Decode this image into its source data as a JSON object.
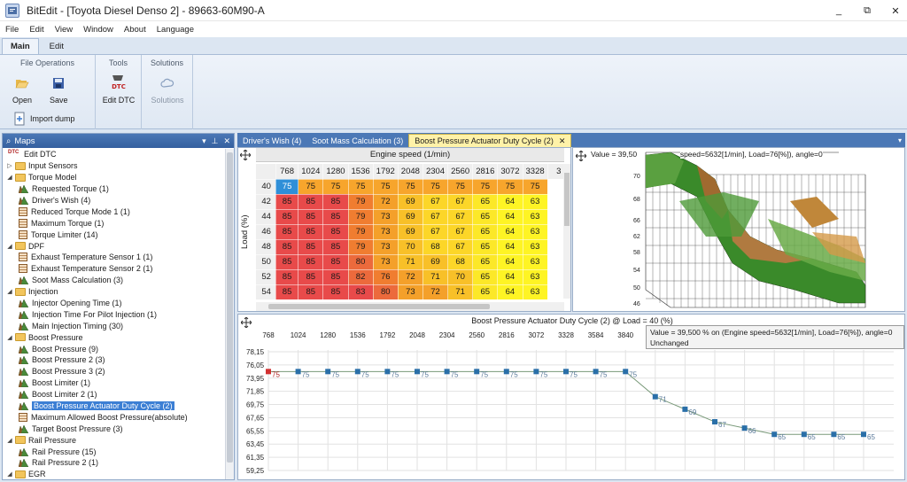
{
  "window": {
    "title": "BitEdit - [Toyota Diesel Denso 2] - 89663-60M90-A",
    "controls": [
      "_",
      "⧉",
      "✕"
    ]
  },
  "menu": [
    "File",
    "Edit",
    "View",
    "Window",
    "About",
    "Language"
  ],
  "ribbon_tabs": [
    "Main",
    "Edit"
  ],
  "ribbon": {
    "file_operations": "File Operations",
    "open": "Open",
    "save": "Save",
    "import_dump": "Import dump",
    "tools": "Tools",
    "edit_dtc": "Edit DTC",
    "solutions_group": "Solutions",
    "solutions": "Solutions"
  },
  "maps_panel": {
    "title": "Maps",
    "items": [
      {
        "label": "Edit DTC",
        "kind": "dtc",
        "level": 0
      },
      {
        "label": "Input Sensors",
        "kind": "folder",
        "level": 0,
        "expanded": false
      },
      {
        "label": "Torque Model",
        "kind": "folder",
        "level": 0,
        "expanded": true
      },
      {
        "label": "Requested Torque (1)",
        "kind": "map3d",
        "level": 1
      },
      {
        "label": "Driver's Wish (4)",
        "kind": "map3d",
        "level": 1
      },
      {
        "label": "Reduced Torque Mode 1 (1)",
        "kind": "table",
        "level": 1
      },
      {
        "label": "Maximum Torque (1)",
        "kind": "table",
        "level": 1
      },
      {
        "label": "Torque Limiter (14)",
        "kind": "table",
        "level": 1
      },
      {
        "label": "DPF",
        "kind": "folder",
        "level": 0,
        "expanded": true
      },
      {
        "label": "Exhaust Temperature Sensor 1 (1)",
        "kind": "table",
        "level": 1
      },
      {
        "label": "Exhaust Temperature Sensor 2 (1)",
        "kind": "table",
        "level": 1
      },
      {
        "label": "Soot Mass Calculation (3)",
        "kind": "map3d",
        "level": 1
      },
      {
        "label": "Injection",
        "kind": "folder",
        "level": 0,
        "expanded": true
      },
      {
        "label": "Injector Opening Time (1)",
        "kind": "map3d",
        "level": 1
      },
      {
        "label": "Injection Time For Pilot Injection (1)",
        "kind": "map3d",
        "level": 1
      },
      {
        "label": "Main Injection Timing (30)",
        "kind": "map3d",
        "level": 1
      },
      {
        "label": "Boost Pressure",
        "kind": "folder",
        "level": 0,
        "expanded": true
      },
      {
        "label": "Boost Pressure (9)",
        "kind": "map3d",
        "level": 1
      },
      {
        "label": "Boost Pressure 2 (3)",
        "kind": "map3d",
        "level": 1
      },
      {
        "label": "Boost Pressure 3 (2)",
        "kind": "map3d",
        "level": 1
      },
      {
        "label": "Boost Limiter (1)",
        "kind": "map3d",
        "level": 1
      },
      {
        "label": "Boost Limiter 2 (1)",
        "kind": "map3d",
        "level": 1
      },
      {
        "label": "Boost Pressure Actuator Duty Cycle (2)",
        "kind": "map3d",
        "level": 1,
        "selected": true
      },
      {
        "label": "Maximum Allowed Boost Pressure(absolute)",
        "kind": "table",
        "level": 1
      },
      {
        "label": "Target Boost Pressure (3)",
        "kind": "map3d",
        "level": 1
      },
      {
        "label": "Rail Pressure",
        "kind": "folder",
        "level": 0,
        "expanded": true
      },
      {
        "label": "Rail Pressure (15)",
        "kind": "map3d",
        "level": 1
      },
      {
        "label": "Rail Pressure 2 (1)",
        "kind": "map3d",
        "level": 1
      },
      {
        "label": "EGR",
        "kind": "folder",
        "level": 0,
        "expanded": true
      }
    ]
  },
  "doc_tabs": [
    {
      "label": "Driver's Wish (4)",
      "active": false
    },
    {
      "label": "Soot Mass Calculation (3)",
      "active": false
    },
    {
      "label": "Boost Pressure Actuator Duty Cycle (2)",
      "active": true
    }
  ],
  "grid": {
    "x_axis_title": "Engine speed (1/min)",
    "y_axis_title": "Load (%)",
    "columns": [
      "768",
      "1024",
      "1280",
      "1536",
      "1792",
      "2048",
      "2304",
      "2560",
      "2816",
      "3072",
      "3328",
      "3"
    ],
    "rows": [
      {
        "load": "40",
        "values": [
          "75",
          "75",
          "75",
          "75",
          "75",
          "75",
          "75",
          "75",
          "75",
          "75",
          "75",
          ""
        ]
      },
      {
        "load": "42",
        "values": [
          "85",
          "85",
          "85",
          "79",
          "72",
          "69",
          "67",
          "67",
          "65",
          "64",
          "63",
          ""
        ]
      },
      {
        "load": "44",
        "values": [
          "85",
          "85",
          "85",
          "79",
          "73",
          "69",
          "67",
          "67",
          "65",
          "64",
          "63",
          ""
        ]
      },
      {
        "load": "46",
        "values": [
          "85",
          "85",
          "85",
          "79",
          "73",
          "69",
          "67",
          "67",
          "65",
          "64",
          "63",
          ""
        ]
      },
      {
        "load": "48",
        "values": [
          "85",
          "85",
          "85",
          "79",
          "73",
          "70",
          "68",
          "67",
          "65",
          "64",
          "63",
          ""
        ]
      },
      {
        "load": "50",
        "values": [
          "85",
          "85",
          "85",
          "80",
          "73",
          "71",
          "69",
          "68",
          "65",
          "64",
          "63",
          ""
        ]
      },
      {
        "load": "52",
        "values": [
          "85",
          "85",
          "85",
          "82",
          "76",
          "72",
          "71",
          "70",
          "65",
          "64",
          "63",
          ""
        ]
      },
      {
        "load": "54",
        "values": [
          "85",
          "85",
          "85",
          "83",
          "80",
          "73",
          "72",
          "71",
          "65",
          "64",
          "63",
          ""
        ]
      }
    ]
  },
  "three_d": {
    "info": "Value = 39,500 % on (Engine speed=5632[1/min], Load=76[%]), angle=0",
    "info_visible": "Value = 39,50",
    "info_visible_2": "speed=5632[1/min], Load=76[%]), angle=0",
    "tick_labels": [
      "70",
      "68",
      "66",
      "62",
      "58",
      "54",
      "50",
      "46"
    ]
  },
  "tooltip": {
    "line1": "Value = 39,500 % on (Engine speed=5632[1/min], Load=76[%]), angle=0",
    "line2": "Unchanged"
  },
  "chart_data": {
    "type": "line",
    "title": "Boost Pressure Actuator Duty Cycle (2) @ Load = 40 (%)",
    "x": [
      768,
      1024,
      1280,
      1536,
      1792,
      2048,
      2304,
      2560,
      2816,
      3072,
      3328,
      3584,
      3840,
      4096,
      4352,
      4608,
      4864,
      5120,
      5376,
      5632,
      5888
    ],
    "x_tick_labels": [
      "768",
      "1024",
      "1280",
      "1536",
      "1792",
      "2048",
      "2304",
      "2560",
      "2816",
      "3072",
      "3328",
      "3584",
      "3840"
    ],
    "y_tick_labels": [
      "78,15",
      "76,05",
      "73,95",
      "71,85",
      "69,75",
      "67,65",
      "65,55",
      "63,45",
      "61,35",
      "59,25"
    ],
    "ylim": [
      59.25,
      78.15
    ],
    "series": [
      {
        "values": [
          75,
          75,
          75,
          75,
          75,
          75,
          75,
          75,
          75,
          75,
          75,
          75,
          75,
          71,
          69,
          67,
          66,
          65,
          65,
          65,
          65
        ],
        "labels": [
          "75",
          "75",
          "75",
          "75",
          "75",
          "75",
          "75",
          "75",
          "75",
          "75",
          "75",
          "75",
          "75",
          "71",
          "69",
          "67",
          "66",
          "65",
          "65",
          "65",
          "65"
        ]
      }
    ],
    "colors": {
      "line": "#7a9a7a",
      "point": "#2a6fa8",
      "first_point": "#d23030",
      "label": "#5a7a9a"
    },
    "grid": true
  }
}
